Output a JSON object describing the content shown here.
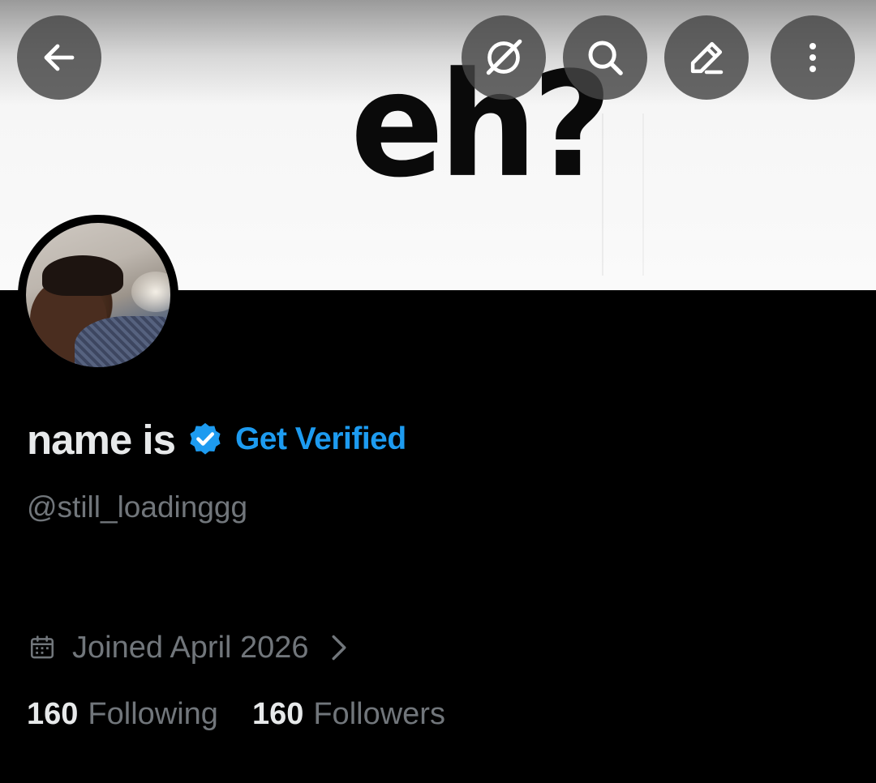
{
  "header": {
    "banner_text": "eh?",
    "buttons": [
      {
        "icon": "arrow-left-icon",
        "label": "Back"
      },
      {
        "icon": "grok-icon",
        "label": "Grok"
      },
      {
        "icon": "search-icon",
        "label": "Search"
      },
      {
        "icon": "edit-icon",
        "label": "Edit"
      },
      {
        "icon": "more-vertical-icon",
        "label": "More"
      }
    ]
  },
  "profile": {
    "display_name": "name is",
    "verified_icon": "verified-badge-icon",
    "get_verified_label": "Get Verified",
    "handle": "@still_loadinggg",
    "joined_icon": "calendar-icon",
    "joined_text": "Joined April 2026",
    "joined_chevron_icon": "chevron-right-icon"
  },
  "stats": {
    "following_count": "160",
    "following_label": "Following",
    "followers_count": "160",
    "followers_label": "Followers"
  },
  "colors": {
    "background": "#000000",
    "primary_text": "#e7e9ea",
    "secondary_text": "#71767b",
    "accent": "#1d9bf0",
    "button_bg": "#464646"
  }
}
